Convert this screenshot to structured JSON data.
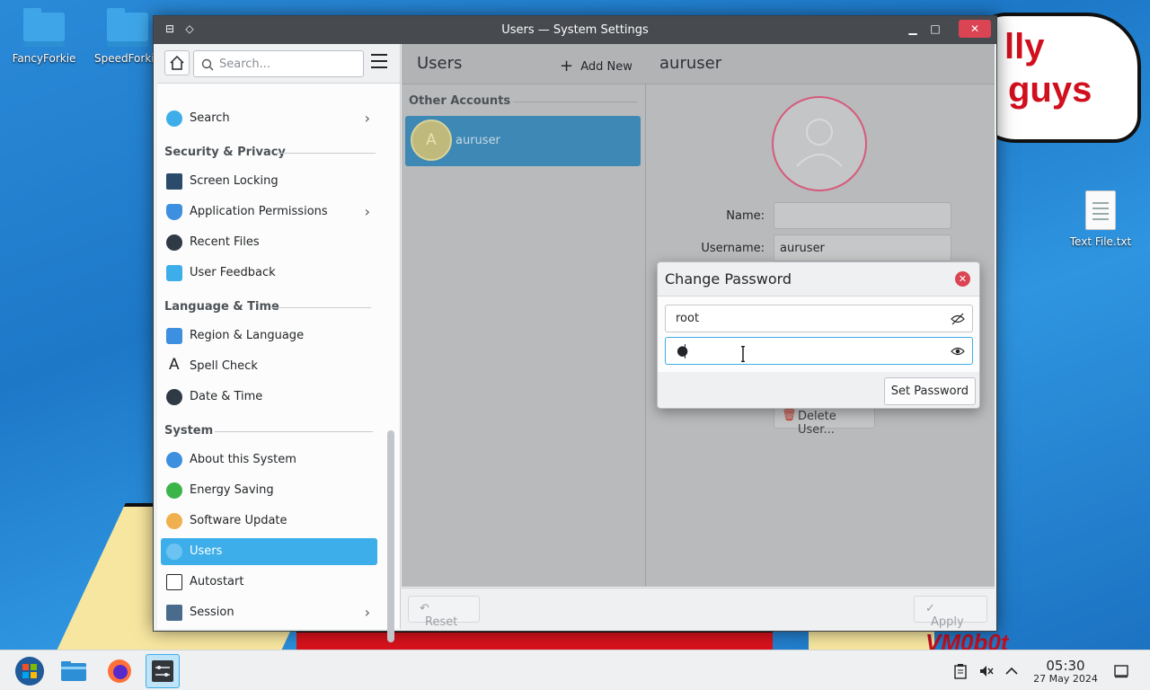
{
  "desktop": {
    "icons": [
      {
        "label": "FancyForkie"
      },
      {
        "label": "SpeedForkie"
      },
      {
        "label": "Text File.txt"
      }
    ],
    "wallpaper_text": [
      "lly",
      "guys",
      "VM0b0t"
    ]
  },
  "window": {
    "title": "Users — System Settings"
  },
  "sidebar": {
    "search_placeholder": "Search...",
    "items": [
      {
        "label": "Search",
        "has_submenu": true
      },
      {
        "section": "Security & Privacy"
      },
      {
        "label": "Screen Locking"
      },
      {
        "label": "Application Permissions",
        "has_submenu": true
      },
      {
        "label": "Recent Files"
      },
      {
        "label": "User Feedback"
      },
      {
        "section": "Language & Time"
      },
      {
        "label": "Region & Language"
      },
      {
        "label": "Spell Check"
      },
      {
        "label": "Date & Time"
      },
      {
        "section": "System"
      },
      {
        "label": "About this System"
      },
      {
        "label": "Energy Saving"
      },
      {
        "label": "Software Update"
      },
      {
        "label": "Users",
        "active": true
      },
      {
        "label": "Autostart"
      },
      {
        "label": "Session",
        "has_submenu": true
      }
    ]
  },
  "users_panel": {
    "title": "Users",
    "add_new_label": "Add New",
    "section_label": "Other Accounts",
    "accounts": [
      {
        "initial": "A",
        "name": "auruser"
      }
    ]
  },
  "user_detail": {
    "title": "auruser",
    "name_label": "Name:",
    "name_value": "",
    "username_label": "Username:",
    "username_value": "auruser",
    "delete_label": "Delete User..."
  },
  "footer": {
    "reset_label": "Reset",
    "apply_label": "Apply"
  },
  "dialog": {
    "title": "Change Password",
    "password_value": "root",
    "confirm_value": "●",
    "set_button_label": "Set Password"
  },
  "taskbar": {
    "time": "05:30",
    "date": "27 May 2024"
  },
  "colors": {
    "accent": "#3daee9",
    "selection_dim": "#3d88b5",
    "close_red": "#da4453"
  }
}
